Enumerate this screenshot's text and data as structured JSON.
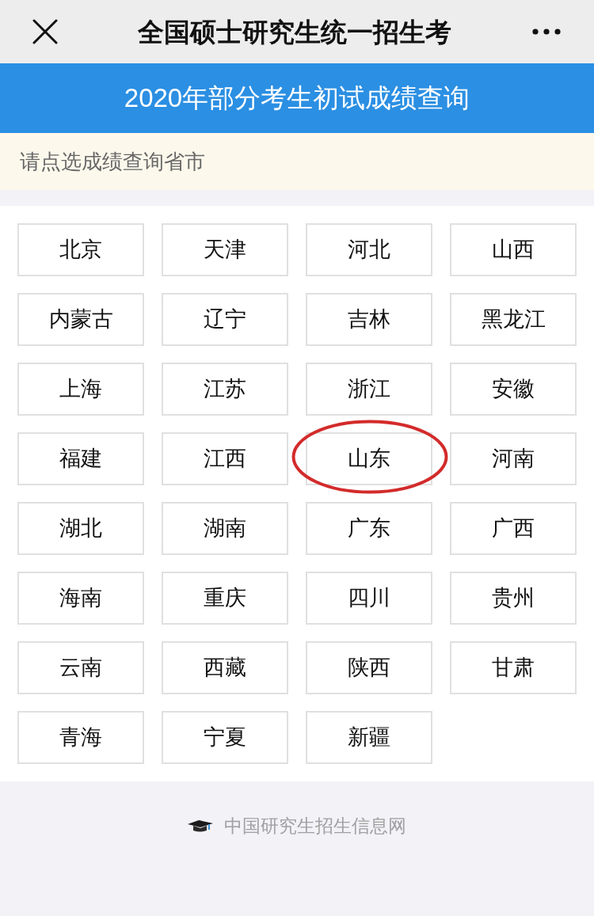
{
  "nav_bar": {
    "title": "全国硕士研究生统一招生考"
  },
  "banner": {
    "title": "2020年部分考生初试成绩查询"
  },
  "notice": {
    "text": "请点选成绩查询省市"
  },
  "provinces": [
    {
      "name": "北京",
      "circled": false
    },
    {
      "name": "天津",
      "circled": false
    },
    {
      "name": "河北",
      "circled": false
    },
    {
      "name": "山西",
      "circled": false
    },
    {
      "name": "内蒙古",
      "circled": false
    },
    {
      "name": "辽宁",
      "circled": false
    },
    {
      "name": "吉林",
      "circled": false
    },
    {
      "name": "黑龙江",
      "circled": false
    },
    {
      "name": "上海",
      "circled": false
    },
    {
      "name": "江苏",
      "circled": false
    },
    {
      "name": "浙江",
      "circled": false
    },
    {
      "name": "安徽",
      "circled": false
    },
    {
      "name": "福建",
      "circled": false
    },
    {
      "name": "江西",
      "circled": false
    },
    {
      "name": "山东",
      "circled": true
    },
    {
      "name": "河南",
      "circled": false
    },
    {
      "name": "湖北",
      "circled": false
    },
    {
      "name": "湖南",
      "circled": false
    },
    {
      "name": "广东",
      "circled": false
    },
    {
      "name": "广西",
      "circled": false
    },
    {
      "name": "海南",
      "circled": false
    },
    {
      "name": "重庆",
      "circled": false
    },
    {
      "name": "四川",
      "circled": false
    },
    {
      "name": "贵州",
      "circled": false
    },
    {
      "name": "云南",
      "circled": false
    },
    {
      "name": "西藏",
      "circled": false
    },
    {
      "name": "陕西",
      "circled": false
    },
    {
      "name": "甘肃",
      "circled": false
    },
    {
      "name": "青海",
      "circled": false
    },
    {
      "name": "宁夏",
      "circled": false
    },
    {
      "name": "新疆",
      "circled": false
    }
  ],
  "footer": {
    "text": "中国研究生招生信息网"
  }
}
